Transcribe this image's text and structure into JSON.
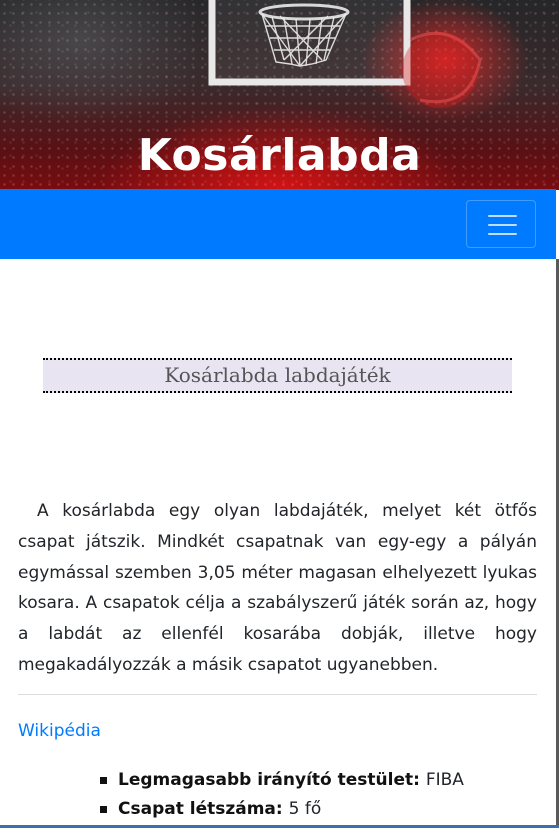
{
  "hero": {
    "title": "Kosárlabda"
  },
  "navbar": {
    "menu_icon": "hamburger-icon",
    "color": "#007bff"
  },
  "subtitle": "Kosárlabda labdajáték",
  "intro_text": "A kosárlabda egy olyan labdajáték, melyet két ötfős csapat játszik. Mindkét csapatnak van egy-egy a pályán egymással szemben 3,05 méter magasan elhelyezett lyukas kosara. A csapatok célja a szabályszerű játék során az, hogy a labdát az ellenfél kosarába dobják, illetve hogy megakadályozzák a másik csapatot ugyanebben.",
  "wiki_link": "Wikipédia",
  "facts": [
    {
      "label": "Legmagasabb irányító testület:",
      "value": "FIBA"
    },
    {
      "label": "Csapat létszáma:",
      "value": "5 fő"
    }
  ],
  "colors": {
    "accent": "#007bff",
    "subtitle_bg": "#e9e4f2"
  }
}
